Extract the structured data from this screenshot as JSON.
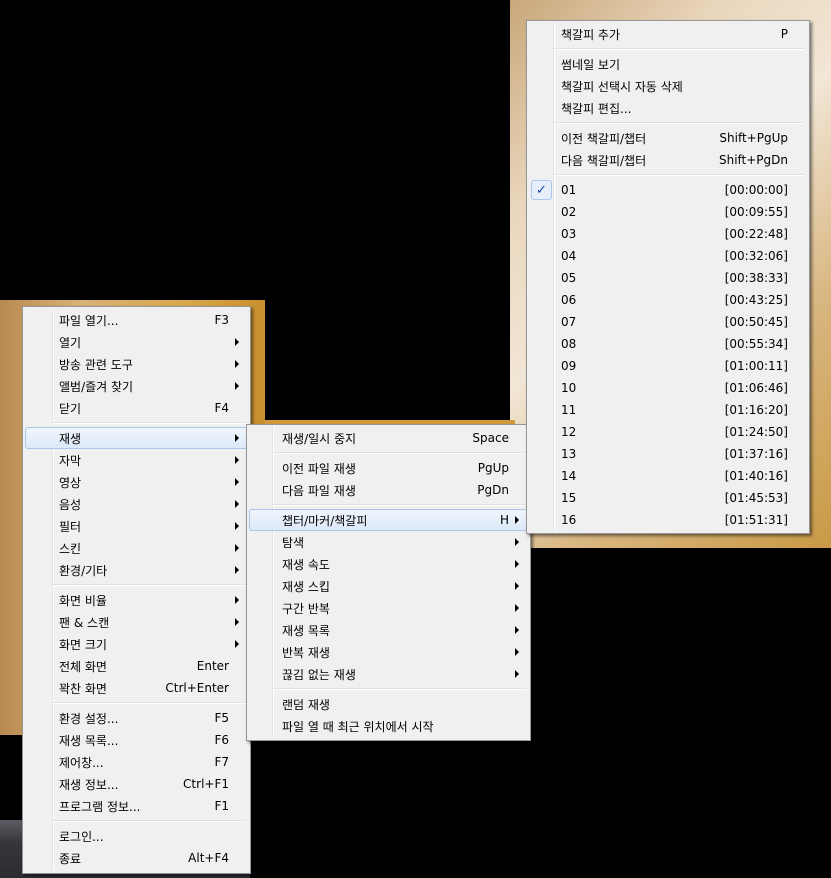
{
  "main_menu": [
    {
      "label": "파일 열기...",
      "shortcut": "F3"
    },
    {
      "label": "열기",
      "submenu": true
    },
    {
      "label": "방송 관련 도구",
      "submenu": true
    },
    {
      "label": "앨범/즐겨 찾기",
      "submenu": true
    },
    {
      "label": "닫기",
      "shortcut": "F4"
    },
    {
      "separator": true
    },
    {
      "label": "재생",
      "submenu": true,
      "highlighted": true
    },
    {
      "label": "자막",
      "submenu": true
    },
    {
      "label": "영상",
      "submenu": true
    },
    {
      "label": "음성",
      "submenu": true
    },
    {
      "label": "필터",
      "submenu": true
    },
    {
      "label": "스킨",
      "submenu": true
    },
    {
      "label": "환경/기타",
      "submenu": true
    },
    {
      "separator": true
    },
    {
      "label": "화면 비율",
      "submenu": true
    },
    {
      "label": "팬 & 스캔",
      "submenu": true
    },
    {
      "label": "화면 크기",
      "submenu": true
    },
    {
      "label": "전체 화면",
      "shortcut": "Enter"
    },
    {
      "label": "꽉찬 화면",
      "shortcut": "Ctrl+Enter"
    },
    {
      "separator": true
    },
    {
      "label": "환경 설정...",
      "shortcut": "F5"
    },
    {
      "label": "재생 목록...",
      "shortcut": "F6"
    },
    {
      "label": "제어창...",
      "shortcut": "F7"
    },
    {
      "label": "재생 정보...",
      "shortcut": "Ctrl+F1"
    },
    {
      "label": "프로그램 정보...",
      "shortcut": "F1"
    },
    {
      "separator": true
    },
    {
      "label": "로그인..."
    },
    {
      "label": "종료",
      "shortcut": "Alt+F4"
    }
  ],
  "playback_menu": [
    {
      "label": "재생/일시 중지",
      "shortcut": "Space"
    },
    {
      "separator": true
    },
    {
      "label": "이전 파일 재생",
      "shortcut": "PgUp"
    },
    {
      "label": "다음 파일 재생",
      "shortcut": "PgDn"
    },
    {
      "separator": true
    },
    {
      "label": "챕터/마커/책갈피",
      "shortcut": "H",
      "submenu": true,
      "highlighted": true
    },
    {
      "label": "탐색",
      "submenu": true
    },
    {
      "label": "재생 속도",
      "submenu": true
    },
    {
      "label": "재생 스킵",
      "submenu": true
    },
    {
      "label": "구간 반복",
      "submenu": true
    },
    {
      "label": "재생 목록",
      "submenu": true
    },
    {
      "label": "반복 재생",
      "submenu": true
    },
    {
      "label": "끊김 없는 재생",
      "submenu": true
    },
    {
      "separator": true
    },
    {
      "label": "랜덤 재생"
    },
    {
      "label": "파일 열 때 최근 위치에서 시작"
    }
  ],
  "chapter_menu": [
    {
      "label": "책갈피 추가",
      "shortcut": "P"
    },
    {
      "separator": true
    },
    {
      "label": "썸네일 보기"
    },
    {
      "label": "책갈피 선택시 자동 삭제"
    },
    {
      "label": "책갈피 편집..."
    },
    {
      "separator": true
    },
    {
      "label": "이전 책갈피/챕터",
      "shortcut": "Shift+PgUp"
    },
    {
      "label": "다음 책갈피/챕터",
      "shortcut": "Shift+PgDn"
    },
    {
      "separator": true
    },
    {
      "label": "01",
      "shortcut": "[00:00:00]",
      "checked": true
    },
    {
      "label": "02",
      "shortcut": "[00:09:55]"
    },
    {
      "label": "03",
      "shortcut": "[00:22:48]"
    },
    {
      "label": "04",
      "shortcut": "[00:32:06]"
    },
    {
      "label": "05",
      "shortcut": "[00:38:33]"
    },
    {
      "label": "06",
      "shortcut": "[00:43:25]"
    },
    {
      "label": "07",
      "shortcut": "[00:50:45]"
    },
    {
      "label": "08",
      "shortcut": "[00:55:34]"
    },
    {
      "label": "09",
      "shortcut": "[01:00:11]"
    },
    {
      "label": "10",
      "shortcut": "[01:06:46]"
    },
    {
      "label": "11",
      "shortcut": "[01:16:20]"
    },
    {
      "label": "12",
      "shortcut": "[01:24:50]"
    },
    {
      "label": "13",
      "shortcut": "[01:37:16]"
    },
    {
      "label": "14",
      "shortcut": "[01:40:16]"
    },
    {
      "label": "15",
      "shortcut": "[01:45:53]"
    },
    {
      "label": "16",
      "shortcut": "[01:51:31]"
    }
  ],
  "checkmark": "✓"
}
